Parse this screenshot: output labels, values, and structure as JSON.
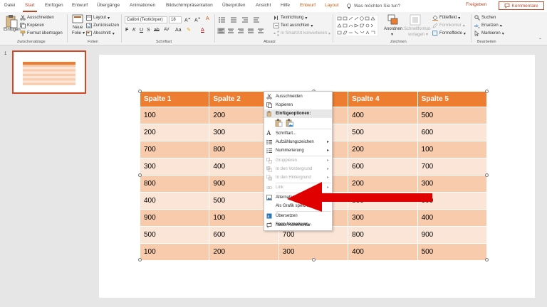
{
  "menubar": {
    "tabs": [
      "Datei",
      "Start",
      "Einfügen",
      "Entwurf",
      "Übergänge",
      "Animationen",
      "Bildschirmpräsentation",
      "Überprüfen",
      "Ansicht",
      "Hilfe"
    ],
    "context_tabs": [
      "Entwurf",
      "Layout"
    ],
    "tell_me": "Was möchten Sie tun?",
    "share": "Freigeben",
    "comments": "Kommentare"
  },
  "ribbon": {
    "clipboard": {
      "label": "Zwischenablage",
      "paste": "Einfügen",
      "cut": "Ausschneiden",
      "copy": "Kopieren",
      "format_painter": "Format übertragen"
    },
    "slides": {
      "label": "Folien",
      "new_slide_line1": "Neue",
      "new_slide_line2": "Folie",
      "layout": "Layout",
      "reset": "Zurücksetzen",
      "section": "Abschnitt"
    },
    "font": {
      "label": "Schriftart",
      "font_name": "Calibri (Textkörper)",
      "font_size": "18"
    },
    "paragraph": {
      "label": "Absatz",
      "text_direction": "Textrichtung",
      "align_text": "Text ausrichten",
      "smartart": "In SmartArt konvertieren"
    },
    "drawing": {
      "label": "Zeichnen",
      "arrange": "Anordnen",
      "quick_styles_line1": "Schnellformat-",
      "quick_styles_line2": "vorlagen",
      "fill": "Fülleffekt",
      "outline": "Formkontur",
      "effects": "Formeffekte"
    },
    "editing": {
      "label": "Bearbeiten",
      "find": "Suchen",
      "replace": "Ersetzen",
      "select": "Markieren"
    }
  },
  "thumbnail": {
    "number": "1"
  },
  "table": {
    "headers": [
      "Spalte 1",
      "Spalte 2",
      "Spalte 3",
      "Spalte 4",
      "Spalte 5"
    ],
    "rows": [
      [
        "100",
        "200",
        "",
        "400",
        "500"
      ],
      [
        "200",
        "300",
        "",
        "500",
        "600"
      ],
      [
        "700",
        "800",
        "",
        "200",
        "100"
      ],
      [
        "300",
        "400",
        "",
        "600",
        "700"
      ],
      [
        "800",
        "900",
        "",
        "200",
        "300"
      ],
      [
        "400",
        "500",
        "",
        "800",
        "900"
      ],
      [
        "900",
        "100",
        "",
        "300",
        "400"
      ],
      [
        "500",
        "600",
        "700",
        "800",
        "900"
      ],
      [
        "100",
        "200",
        "300",
        "400",
        "500"
      ]
    ]
  },
  "context_menu": {
    "cut": "Ausschneiden",
    "copy": "Kopieren",
    "paste_options": "Einfügeoptionen:",
    "font": "Schriftart...",
    "bullets": "Aufzählungszeichen",
    "numbering": "Nummerierung",
    "group": "Gruppieren",
    "bring_front": "In den Vordergrund",
    "send_back": "In den Hintergrund",
    "link": "Link",
    "alt_text": "Alternativtext bearbeiten...",
    "save_as_picture": "Als Grafik speichern...",
    "translate": "Übersetzen",
    "format_shape": "Form formatieren...",
    "new_comment": "Neuer Kommentar"
  },
  "colors": {
    "accent": "#b7472a",
    "header_fill": "#ed7d31",
    "row_dark": "#f8cbad",
    "row_light": "#fbe5d6",
    "arrow": "#e00000"
  }
}
